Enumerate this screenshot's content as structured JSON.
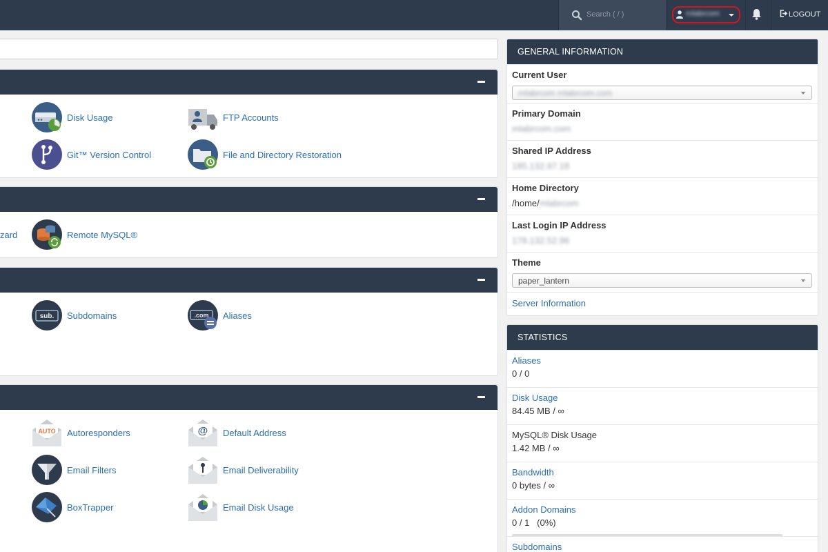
{
  "topbar": {
    "search_placeholder": "Search ( / )",
    "username": "rnlabrcom",
    "logout_label": "LOGOUT"
  },
  "panels": {
    "files": {
      "items": [
        {
          "label": "Disk Usage",
          "icon": "disk-usage-icon"
        },
        {
          "label": "FTP Accounts",
          "icon": "ftp-accounts-icon"
        },
        {
          "label": "Git™ Version Control",
          "icon": "git-icon"
        },
        {
          "label": "File and Directory Restoration",
          "icon": "file-restore-icon"
        }
      ]
    },
    "databases": {
      "partial_label": "zard",
      "items": [
        {
          "label": "Remote MySQL®",
          "icon": "remote-mysql-icon"
        }
      ]
    },
    "domains": {
      "items": [
        {
          "label": "Subdomains",
          "icon": "subdomains-icon"
        },
        {
          "label": "Aliases",
          "icon": "aliases-icon"
        }
      ]
    },
    "email": {
      "items": [
        {
          "label": "Autoresponders",
          "icon": "autoresponders-icon"
        },
        {
          "label": "Default Address",
          "icon": "default-address-icon"
        },
        {
          "label": "Email Filters",
          "icon": "email-filters-icon"
        },
        {
          "label": "Email Deliverability",
          "icon": "email-deliverability-icon"
        },
        {
          "label": "BoxTrapper",
          "icon": "boxtrapper-icon"
        },
        {
          "label": "Email Disk Usage",
          "icon": "email-disk-usage-icon"
        }
      ]
    }
  },
  "general_info": {
    "title": "GENERAL INFORMATION",
    "current_user_label": "Current User",
    "current_user_value": "rnlabrcom rnlabrcom.com",
    "primary_domain_label": "Primary Domain",
    "primary_domain_value": "mlabrcom.com",
    "shared_ip_label": "Shared IP Address",
    "shared_ip_value": "185.132.97.18",
    "home_dir_label": "Home Directory",
    "home_dir_prefix": "/home/",
    "home_dir_user": "mlabrcom",
    "last_login_label": "Last Login IP Address",
    "last_login_value": "178.132.52.96",
    "theme_label": "Theme",
    "theme_value": "paper_lantern",
    "server_info_link": "Server Information"
  },
  "statistics": {
    "title": "STATISTICS",
    "rows": [
      {
        "label": "Aliases",
        "value": "0 / 0",
        "link": true
      },
      {
        "label": "Disk Usage",
        "value": "84.45 MB / ∞",
        "link": true
      },
      {
        "label": "MySQL® Disk Usage",
        "value": "1.42 MB / ∞",
        "link": false
      },
      {
        "label": "Bandwidth",
        "value": "0 bytes / ∞",
        "link": true
      },
      {
        "label": "Addon Domains",
        "value": "0 / 1   (0%)",
        "link": true,
        "progress": 0.0
      }
    ],
    "next_label": "Subdomains"
  },
  "colors": {
    "header_bg": "#2e3b4d",
    "link": "#2b6fb0",
    "highlight_border": "#d4141e"
  }
}
